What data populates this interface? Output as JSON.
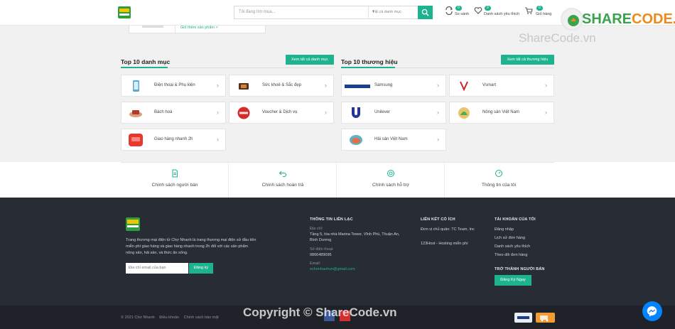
{
  "header": {
    "search_placeholder": "Tôi đang tìm mua...",
    "category_select": "Tất cả danh mục",
    "compare": {
      "label": "So sánh",
      "count": "0"
    },
    "wishlist": {
      "label": "Danh sách yêu thích",
      "count": "0"
    },
    "cart": {
      "label": "Giỏ hàng",
      "count": "0"
    }
  },
  "partial_card": {
    "link": "Giỏ thêm sản phẩm >"
  },
  "categories": {
    "title": "Top 10 danh mục",
    "view_all": "Xem tất cả danh mục",
    "items": [
      {
        "label": "Điện thoại & Phụ kiện",
        "icon": "phone-icon"
      },
      {
        "label": "Sức khoẻ & Sắc đẹp",
        "icon": "beauty-icon"
      },
      {
        "label": "Bách hoá",
        "icon": "grocery-icon"
      },
      {
        "label": "Voucher & Dịch vụ",
        "icon": "voucher-icon"
      },
      {
        "label": "Giao hàng nhanh 2h",
        "icon": "delivery-icon"
      }
    ]
  },
  "brands": {
    "title": "Top 10 thương hiệu",
    "view_all": "Xem tất cả thương hiệu",
    "items": [
      {
        "label": "Samsung",
        "icon": "samsung-logo"
      },
      {
        "label": "Vsmart",
        "icon": "vsmart-logo"
      },
      {
        "label": "Unilever",
        "icon": "unilever-logo"
      },
      {
        "label": "Nông sản Việt Nam",
        "icon": "agriculture-logo"
      },
      {
        "label": "Hải sản Việt Nam",
        "icon": "seafood-logo"
      }
    ]
  },
  "policies": [
    {
      "label": "Chính sách người bán",
      "icon": "document-icon"
    },
    {
      "label": "Chính sách hoàn trả",
      "icon": "return-icon"
    },
    {
      "label": "Chính sách hỗ trợ",
      "icon": "support-icon"
    },
    {
      "label": "Thông tin của tôi",
      "icon": "info-icon"
    }
  ],
  "footer": {
    "description": "Trang thương mại điện tử Chợ Nhanh là trang thương mại điện sử đầu tiên miễn phí giao hàng và giao hàng nhanh trong 2h đối với các sản phẩm nông sản, hải sản, và thức ăn sống.",
    "newsletter_placeholder": "Địa chỉ email của bạn",
    "newsletter_button": "Đăng ký",
    "contact": {
      "heading": "THÔNG TIN LIÊN LẠC",
      "address_label": "Địa chỉ:",
      "address": "Tầng 5, tòa nhà Marina Tower, Vĩnh Phú, Thuận An, Bình Dương",
      "phone_label": "Số điện thoại:",
      "phone": "0866489095",
      "email_label": "Email:",
      "email": "echonhanhvn@gmail.com"
    },
    "links": {
      "heading": "LIÊN KẾT CÓ ÍCH",
      "items": [
        "Đơn vị chủ quản: TC Team, Inc",
        "123Host - Hosting miễn phí"
      ]
    },
    "account": {
      "heading": "TÀI KHOẢN CỦA TÔI",
      "items": [
        "Đăng nhập",
        "Lịch sử đơn hàng",
        "Danh sách yêu thích",
        "Theo dõi đơn hàng"
      ]
    },
    "seller": {
      "heading": "TRỞ THÀNH NGƯỜI BÁN",
      "button": "Đăng Ký Ngay"
    }
  },
  "bottom": {
    "copyright": "© 2021 Chợ Nhanh",
    "terms": "Điều khoản",
    "privacy": "Chính sách bảo mật"
  },
  "watermark": {
    "logo_a": "SHARE",
    "logo_b": "CODE.vn",
    "middle": "ShareCode.vn",
    "bottom": "Copyright © ShareCode.vn"
  },
  "colors": {
    "accent": "#1db38e",
    "footer": "#282c34",
    "footer_bottom": "#1f2228"
  }
}
